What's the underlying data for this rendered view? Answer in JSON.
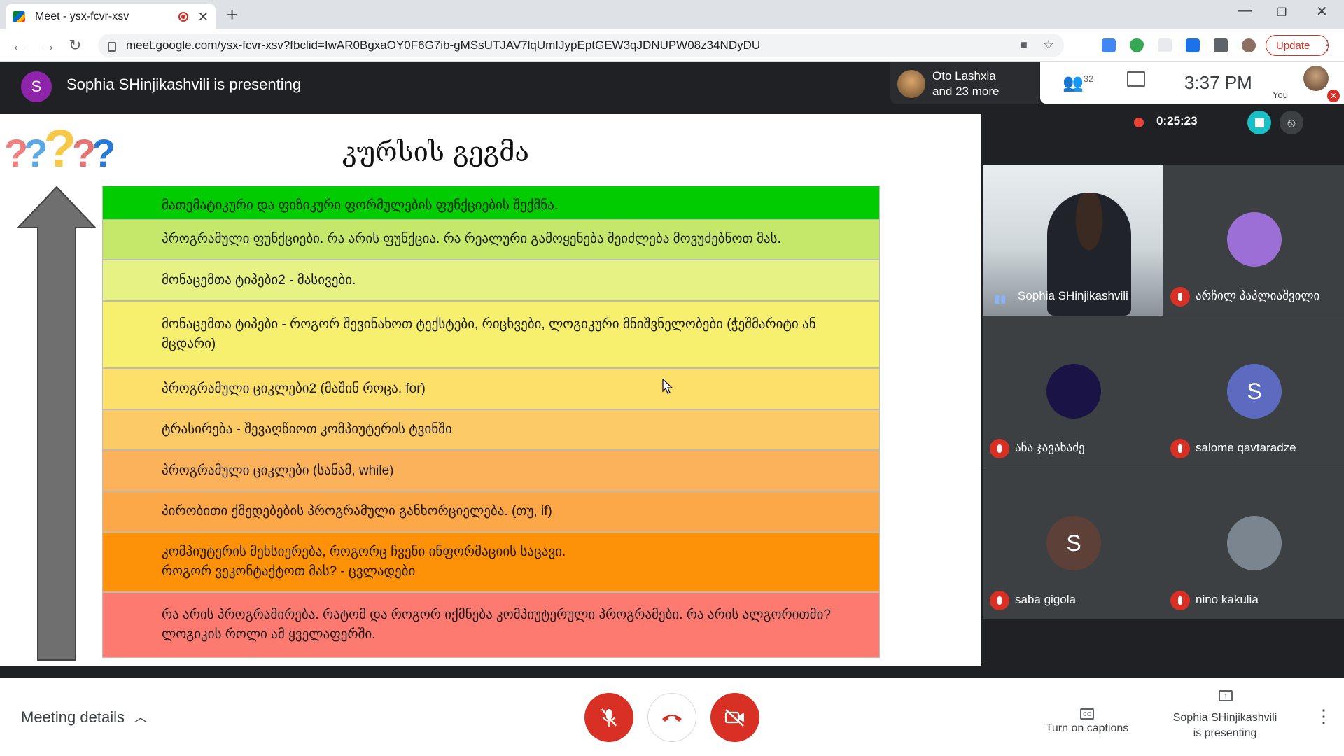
{
  "browser": {
    "tab_title": "Meet - ysx-fcvr-xsv",
    "url": "meet.google.com/ysx-fcvr-xsv?fbclid=IwAR0BgxaOY0F6G7ib-gMSsUTJAV7lqUmIJypEptGEW3qJDNUPW08z34NDyDU",
    "update_label": "Update"
  },
  "meet": {
    "presenter_initial": "S",
    "presenting_text": "Sophia SHinjikashvili is presenting",
    "others_line1": "Oto Lashxia",
    "others_line2": "and 23 more",
    "participants_count": "32",
    "clock": "3:37 PM",
    "you_label": "You",
    "recording_time": "0:25:23"
  },
  "slide": {
    "title": "კურსის გეგმა",
    "rows": [
      {
        "text": "მათემატიკური და ფიზიკური ფორმულების ფუნქციების შექმნა.",
        "color": "#00cc00"
      },
      {
        "text": "პროგრამული ფუნქციები. რა არის ფუნქცია. რა რეალური გამოყენება შეიძლება მოვუძებნოთ მას.",
        "color": "#c5e86b"
      },
      {
        "text": "მონაცემთა ტიპები2 - მასივები.",
        "color": "#e6f283"
      },
      {
        "text": "მონაცემთა ტიპები - როგორ შევინახოთ ტექსტები, რიცხვები, ლოგიკური მნიშვნელობები (ჭეშმარიტი ან მცდარი)",
        "color": "#f7ef6e"
      },
      {
        "text": "პროგრამული ციკლები2 (მაშინ როცა, for)",
        "color": "#fde06a"
      },
      {
        "text": "ტრასირება - შევაღწიოთ კომპიუტერის ტვინში",
        "color": "#fdcb66"
      },
      {
        "text": "პროგრამული ციკლები (სანამ, while)",
        "color": "#fcb25a"
      },
      {
        "text": "პირობითი ქმედებების პროგრამული განხორციელება. (თუ, if)",
        "color": "#fca848"
      },
      {
        "text": "კომპიუტერის მეხსიერება, როგორც ჩვენი ინფორმაციის საცავი.\nროგორ ვეკონტაქტოთ მას? - ცვლადები",
        "color": "#fd9107"
      },
      {
        "text": "რა არის პროგრამირება. რატომ და როგორ იქმნება კომპიუტერული პროგრამები. რა არის ალგორითმი? ლოგიკის როლი ამ ყველაფერში.",
        "color": "#fc7a6f"
      }
    ]
  },
  "participants": [
    {
      "name": "Sophia SHinjikashvili",
      "type": "video"
    },
    {
      "name": "არჩილ პაპლიაშვილი",
      "type": "avatar",
      "initial": "",
      "color": "#9c6fd6"
    },
    {
      "name": "ანა ჯავახაძე",
      "type": "avatar",
      "initial": "",
      "color": "#1a1446"
    },
    {
      "name": "salome qavtaradze",
      "type": "avatar",
      "initial": "S",
      "color": "#5c6bc0"
    },
    {
      "name": "saba gigola",
      "type": "avatar",
      "initial": "S",
      "color": "#5d4037"
    },
    {
      "name": "nino kakulia",
      "type": "avatar",
      "initial": "",
      "color": "#7a8590"
    }
  ],
  "bottom": {
    "meeting_details": "Meeting details",
    "captions": "Turn on captions",
    "presenting_line1": "Sophia SHinjikashvili",
    "presenting_line2": "is presenting"
  }
}
